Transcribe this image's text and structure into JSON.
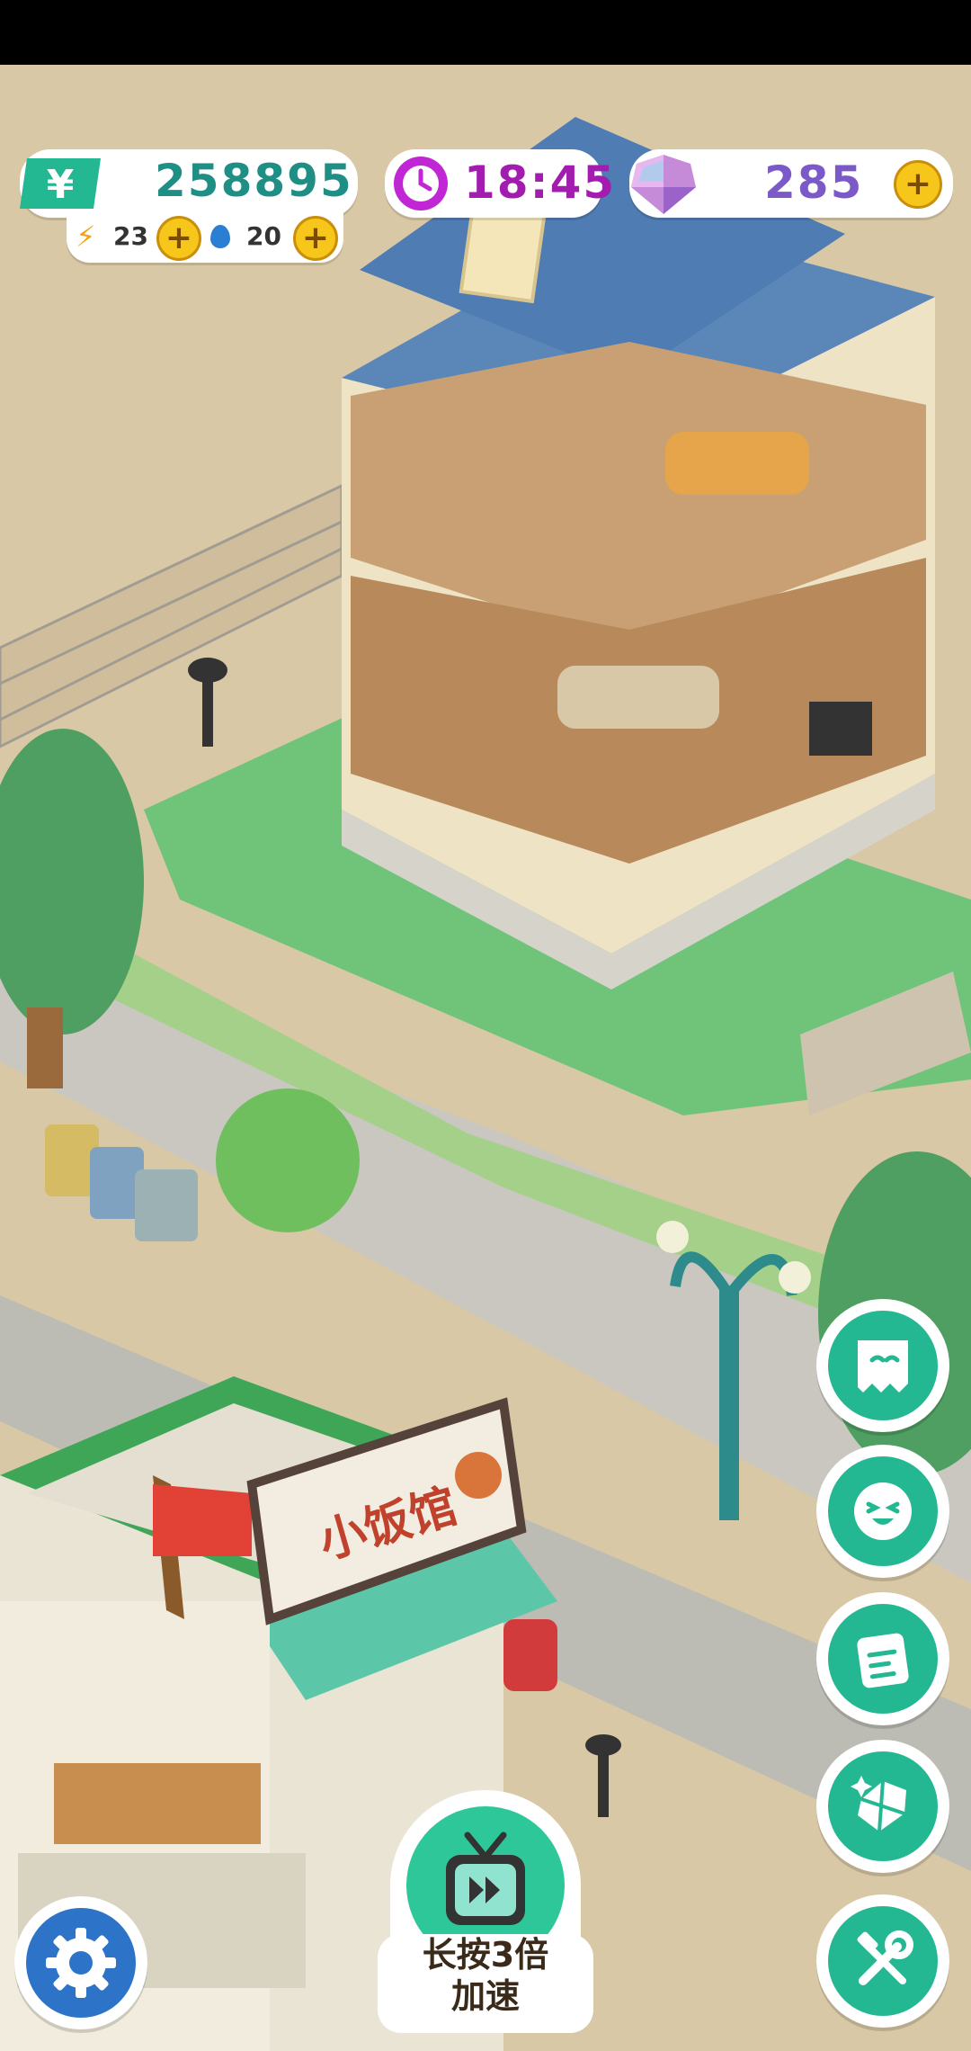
{
  "hud": {
    "money": "258895",
    "energy": "23",
    "water": "20",
    "time": "18:45",
    "gems": "285",
    "plus": "+"
  },
  "restaurant_sign": "小饭馆",
  "speed_button": {
    "line1": "长按3倍",
    "line2": "加速"
  },
  "icons": {
    "money": "yuan-icon",
    "energy": "lightning-icon",
    "water": "water-drop-icon",
    "clock": "clock-icon",
    "gem": "gem-icon",
    "side": [
      "ghost-chat-icon",
      "emoji-face-icon",
      "notepad-icon",
      "diamond-icon",
      "tools-icon"
    ],
    "settings": "gear-icon",
    "speed": "tv-fast-forward-icon"
  },
  "colors": {
    "accent_green": "#23b892",
    "money_text": "#1f8f86",
    "clock_text": "#a21caf",
    "gem_text": "#7c59c9",
    "plus_yellow": "#f7c61a",
    "settings_blue": "#2d74c9"
  }
}
